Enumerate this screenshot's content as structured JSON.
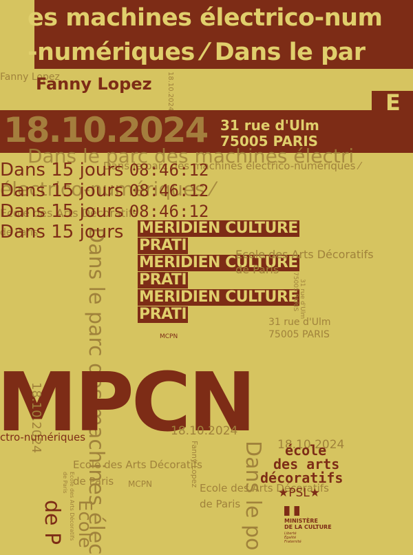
{
  "banner": {
    "line1": "es machines électrico-num",
    "line2": "-numériques ⁄ Dans le par"
  },
  "author": "Fanny Lopez",
  "author_small": "Fanny Lopez",
  "date_small": "18.10.2024",
  "date_band": {
    "date": "18.10.2024",
    "address_line1": "31 rue d'Ulm",
    "address_line2": "75005 PARIS",
    "corner": "E"
  },
  "ghost_titles": {
    "big": "Dans le parc des machines électri",
    "small": "Dans le parc des machines électrico-numériques ⁄",
    "mid": "électrico-numériques ⁄",
    "lines": [
      "Ecole des Arts Décoratifs",
      "de Paris"
    ]
  },
  "countdown": {
    "prefix": "Dans 15 jours",
    "time": "08:46:12",
    "repeat": 4
  },
  "boxes": {
    "line1": "MERIDIEN CULTURE",
    "line2": "PRATI"
  },
  "ecole": {
    "name": "Ecole des Arts Décoratifs",
    "city": "de Paris"
  },
  "address": {
    "line1": "31 rue d'Ulm",
    "line2": "75005 PARIS"
  },
  "small_labels": {
    "mcpn": "MCPN",
    "date_vert": "18.10.2024",
    "numeriques": "ctro-numériques",
    "ecole_vert": "Ecole des Arts Décoratifs",
    "de_paris_vert": "de Paris"
  },
  "mpcn": "MPCN",
  "vertical_big": {
    "dans_le_parc": "Dans le parc des machines élec",
    "ecole_partial": "Ecole",
    "de_p": "de P",
    "dans_le_po": "Dans le po"
  },
  "logos": {
    "ensad_line1": "école",
    "ensad_line2": "des arts",
    "ensad_line3": "décoratifs",
    "psl": "PSL",
    "ministere_line1": "MINISTÈRE",
    "ministere_line2": "DE LA CULTURE",
    "ministere_motto": "Liberté Égalité Fraternité"
  },
  "colors": {
    "background": "#d6c460",
    "brown": "#7d2c16",
    "tan": "#a0823b",
    "cream": "#e0cf6c"
  }
}
